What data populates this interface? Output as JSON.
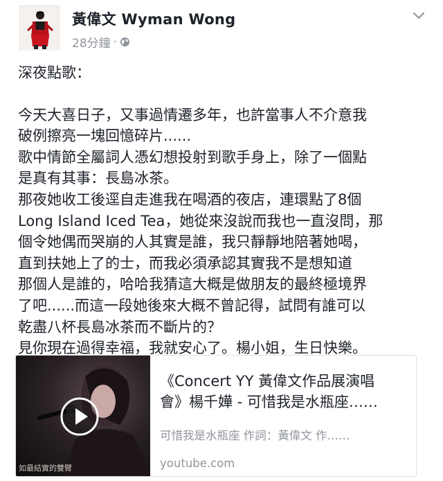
{
  "post": {
    "author": "黃偉文 Wyman Wong",
    "time": "28分鐘",
    "separator": "·",
    "privacy_icon": "globe-icon",
    "menu_icon": "chevron-down-icon",
    "greeting": "深夜點歌：",
    "lines": [
      "今天大喜日子，又事過情遷多年，也許當事人不介意我",
      "破例擦亮一塊回憶碎片......",
      "歌中情節全屬詞人憑幻想投射到歌手身上，除了一個點",
      "是真有其事：長島冰茶。",
      "那夜她收工後逕自走進我在喝酒的夜店，連環點了8個",
      "Long Island Iced Tea，她從來沒說而我也一直沒問，那",
      "個令她偶而哭崩的人其實是誰，我只靜靜地陪著她喝，",
      "直到扶她上了的士，而我必須承認其實我不是想知道",
      "那個人是誰的，哈哈我猜這大概是做朋友的最終極境界",
      "了吧......而這一段她後來大概不曾記得，試問有誰可以",
      "乾盡八杯長島冰茶而不斷片的？",
      "見你現在過得幸福，我就安心了。楊小姐，生日快樂。"
    ]
  },
  "link_card": {
    "title_line1": "《Concert YY 黃偉文作品展演唱",
    "title_line2": "會》楊千嬅 - 可惜我是水瓶座……",
    "description": "可惜我是水瓶座 作詞：黃偉文 作……",
    "domain": "youtube.com",
    "thumb_caption": "如最結實的雙臂",
    "play_icon": "play-icon"
  },
  "colors": {
    "text": "#1d2129",
    "secondary": "#90949c",
    "border": "#dddfe2"
  }
}
